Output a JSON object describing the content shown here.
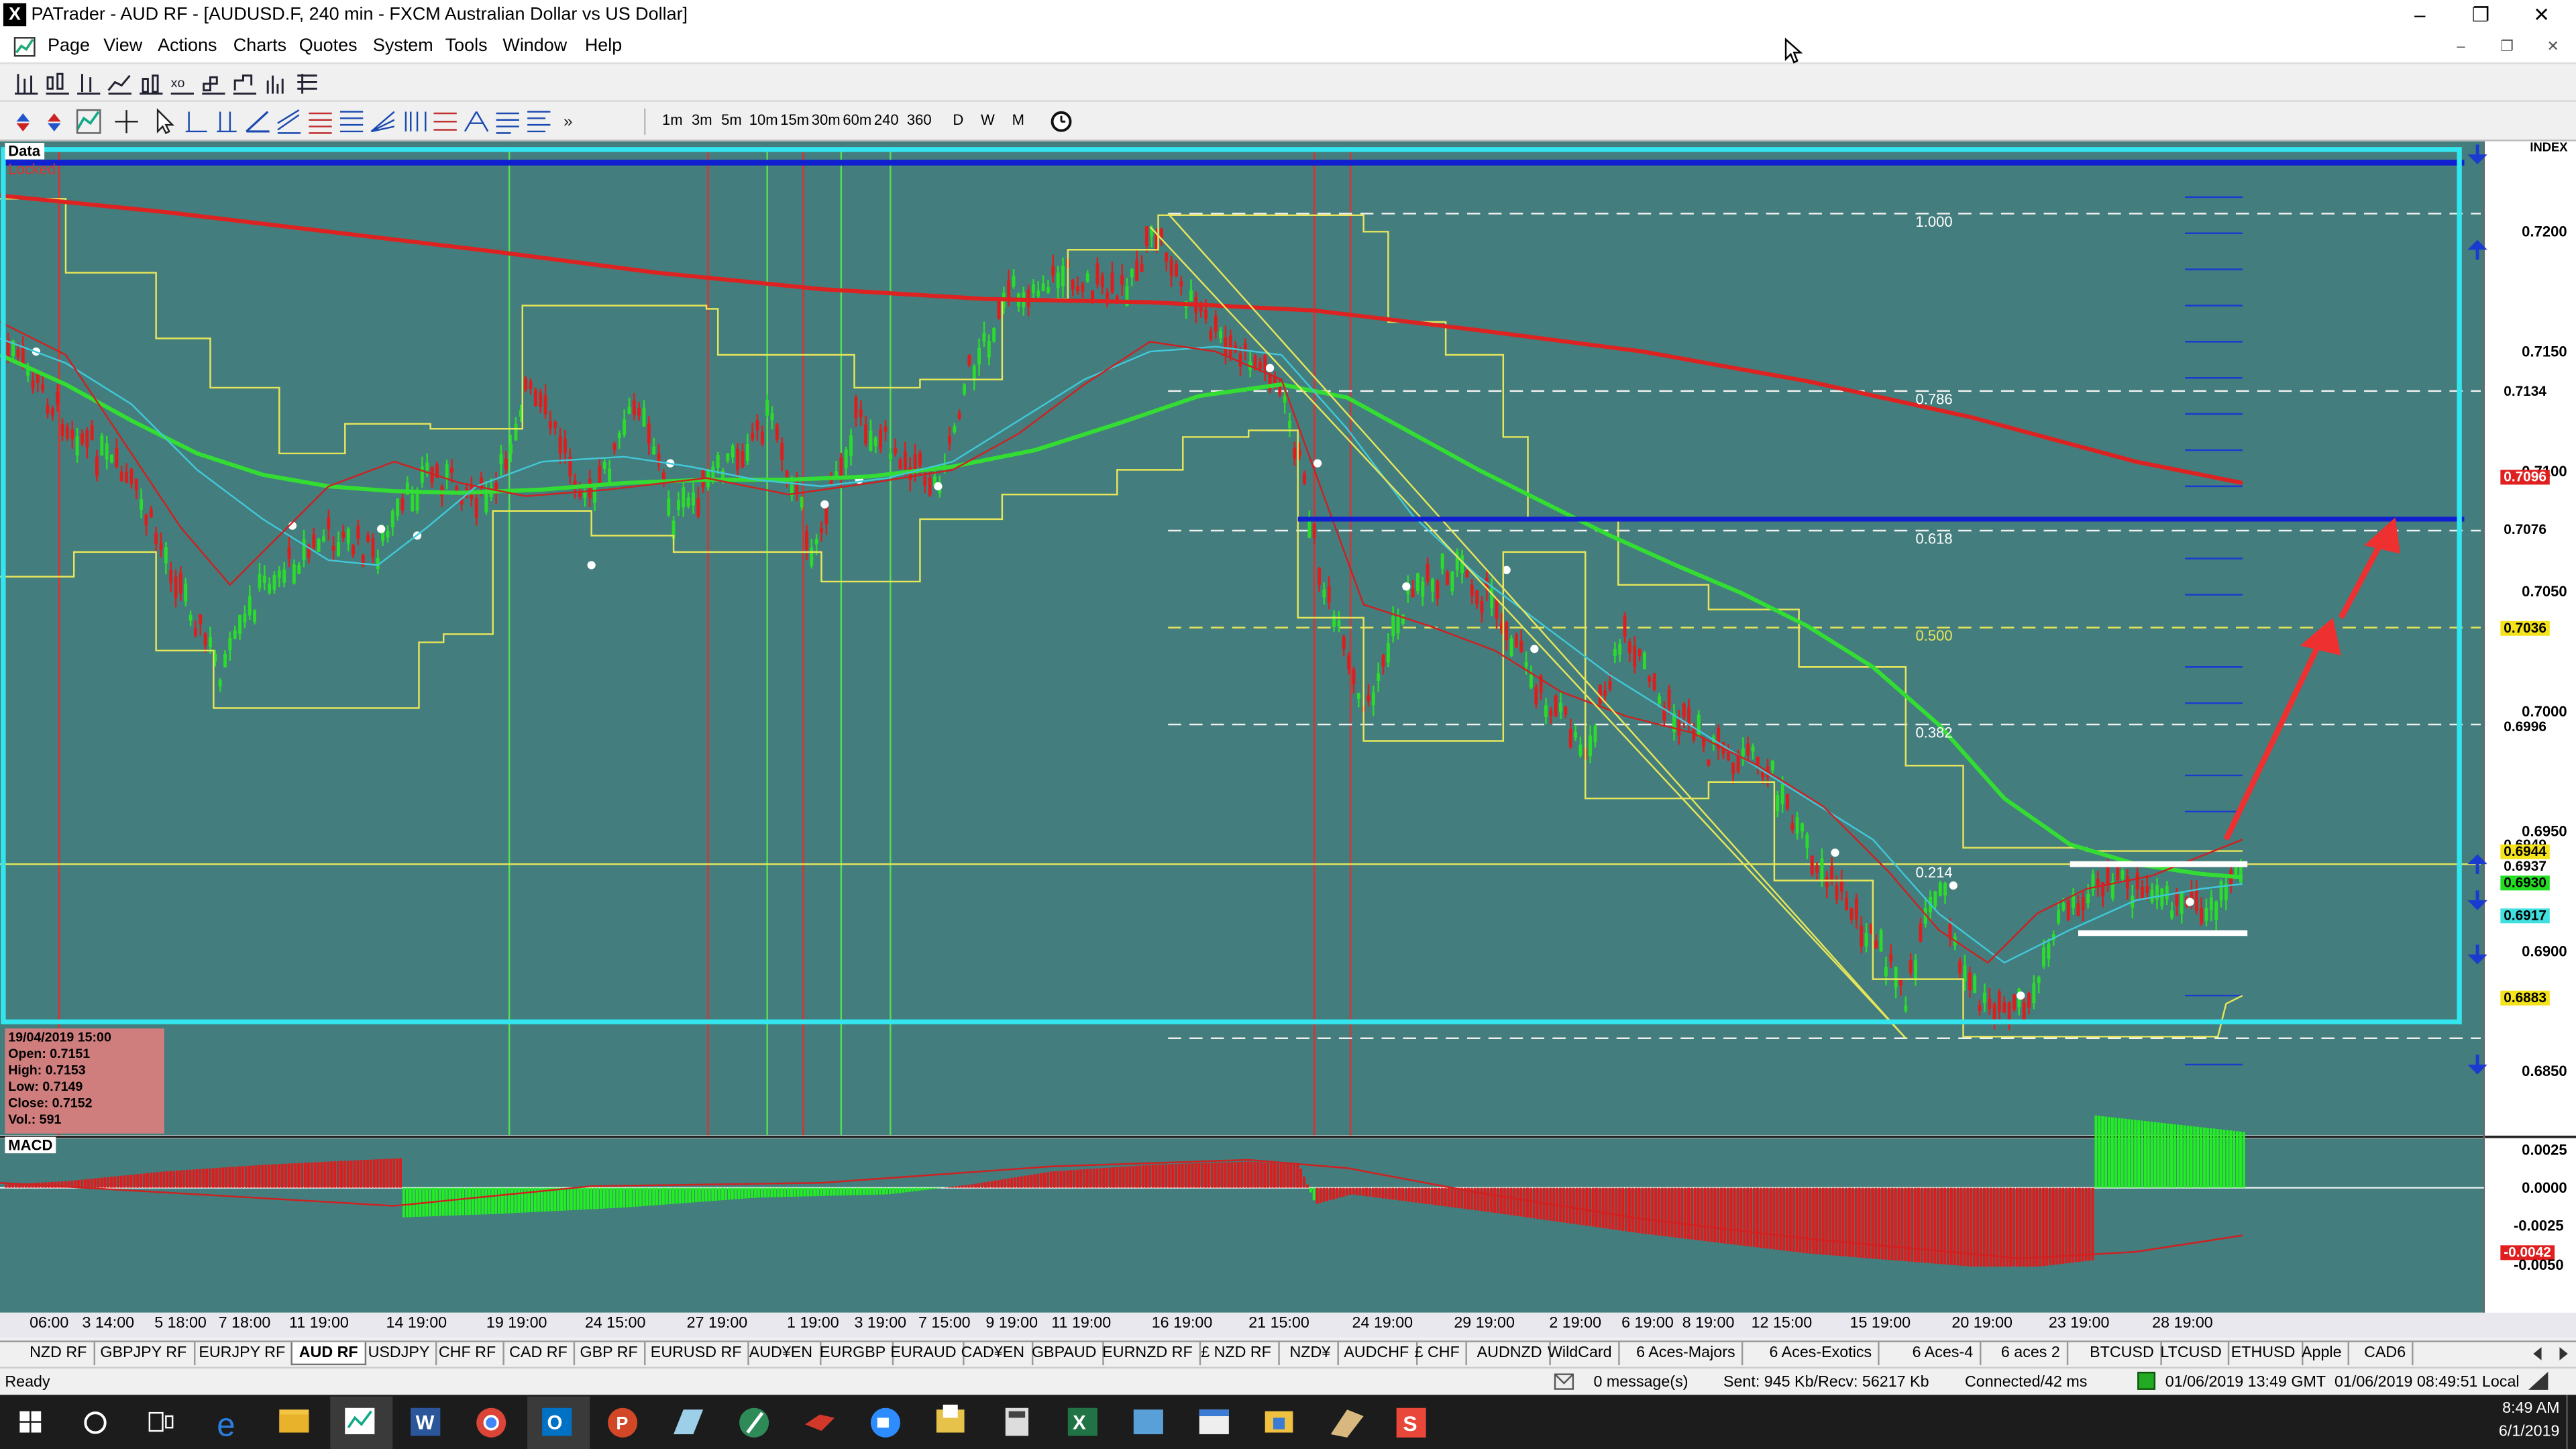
{
  "window": {
    "app_icon": "X",
    "title": "PATrader - AUD RF - [AUDUSD.F, 240 min - FXCM Australian Dollar vs US Dollar]",
    "min": "–",
    "max": "❐",
    "close": "✕"
  },
  "menu": {
    "items": [
      "Page",
      "View",
      "Actions",
      "Charts",
      "Quotes",
      "System",
      "Tools",
      "Window",
      "Help"
    ],
    "mdi_min": "–",
    "mdi_restore": "❐",
    "mdi_close": "✕"
  },
  "timeframes": [
    "1m",
    "3m",
    "5m",
    "10m",
    "15m",
    "30m",
    "60m",
    "240",
    "360",
    "D",
    "W",
    "M"
  ],
  "chart": {
    "data_label": "Data",
    "locked_label": "Locked",
    "index_label": "INDEX",
    "macd_label": "MACD",
    "price_axis": [
      "0.7200",
      "0.7150",
      "0.7100",
      "0.7050",
      "0.7000",
      "0.6950",
      "0.6900",
      "0.6850"
    ],
    "price_tags": [
      {
        "text": "0.7134",
        "bg": "#ffffff",
        "fg": "#000000"
      },
      {
        "text": "0.7096",
        "bg": "#e02020",
        "fg": "#ffffff"
      },
      {
        "text": "0.7076",
        "bg": "#ffffff",
        "fg": "#000000"
      },
      {
        "text": "0.7036",
        "bg": "#f4e21a",
        "fg": "#000000"
      },
      {
        "text": "0.6996",
        "bg": "#ffffff",
        "fg": "#000000"
      },
      {
        "text": "0.6949",
        "bg": "#ffffff",
        "fg": "#000000"
      },
      {
        "text": "0.6944",
        "bg": "#f4e21a",
        "fg": "#000000"
      },
      {
        "text": "0.6937",
        "bg": "#ffffff",
        "fg": "#000000"
      },
      {
        "text": "0.6930",
        "bg": "#22dd22",
        "fg": "#000000"
      },
      {
        "text": "0.6917",
        "bg": "#40e0e0",
        "fg": "#000000"
      },
      {
        "text": "0.6883",
        "bg": "#f4e21a",
        "fg": "#000000"
      }
    ],
    "fib_levels": [
      "1.000",
      "0.786",
      "0.618",
      "0.500",
      "0.382",
      "0.214"
    ],
    "macd_axis": [
      "0.0025",
      "0.0000",
      "-0.0025",
      "-0.0042",
      "-0.0050"
    ],
    "dates": [
      "06:00",
      "3 14:00",
      "5 18:00",
      "7 18:00",
      "11 19:00",
      "14 19:00",
      "19 19:00",
      "24 15:00",
      "27 19:00",
      "1 19:00",
      "3 19:00",
      "7 15:00",
      "9 19:00",
      "11 19:00",
      "16 19:00",
      "21 15:00",
      "24 19:00",
      "29 19:00",
      "2 19:00",
      "6 19:00",
      "8 19:00",
      "12 15:00",
      "15 19:00",
      "20 19:00",
      "23 19:00",
      "28 19:00"
    ]
  },
  "ohlc": {
    "date": "19/04/2019 15:00",
    "open": "Open: 0.7151",
    "high": "High: 0.7153",
    "low": "Low: 0.7149",
    "close": "Close: 0.7152",
    "vol": "Vol.: 591"
  },
  "symbol_tabs": [
    "NZD RF",
    "GBPJPY RF",
    "EURJPY RF",
    "AUD RF",
    "USDJPY",
    "CHF RF",
    "CAD RF",
    "GBP RF",
    "EURUSD RF",
    "AUD¥EN",
    "EURGBP",
    "EURAUD",
    "CAD¥EN",
    "GBPAUD",
    "EURNZD RF",
    "£ NZD RF",
    "NZD¥",
    "AUDCHF",
    "£ CHF",
    "AUDNZD",
    "WildCard",
    "6 Aces-Majors",
    "6 Aces-Exotics",
    "6 Aces-4",
    "6 aces 2",
    "BTCUSD",
    "LTCUSD",
    "ETHUSD",
    "Apple",
    "CAD6"
  ],
  "active_tab": "AUD RF",
  "status": {
    "ready": "Ready",
    "messages": "0 message(s)",
    "traffic": "Sent: 945 Kb/Recv: 56217 Kb",
    "connection": "Connected/42 ms",
    "gmt_time": "01/06/2019 13:49 GMT",
    "local_time": "01/06/2019 08:49:51 Local"
  },
  "taskbar": {
    "time": "8:49 AM",
    "date": "6/1/2019",
    "apps": [
      "start-icon",
      "cortana-icon",
      "task-view-icon",
      "edge-icon",
      "explorer-icon",
      "patrader-icon",
      "word-icon",
      "chrome-icon",
      "outlook-icon",
      "powerpoint-icon",
      "notes-icon",
      "ninja-icon",
      "app-bird-icon",
      "zoom-icon",
      "folder-doc-icon",
      "calculator-icon",
      "excel-icon",
      "app-blue-icon",
      "app-window-icon",
      "app-folder-icon",
      "app-tool-icon",
      "snagit-icon"
    ]
  },
  "colors": {
    "chart_bg": "#447d7d",
    "up_candle": "#2bdc2b",
    "down_candle": "#e01d1d",
    "ma_red": "#dd2222",
    "ma_green": "#33dd33",
    "ma_cyan": "#40c8d8",
    "channel_yellow": "#e6e65a",
    "level_blue": "#1020d0",
    "box_cyan": "#33e5ee"
  }
}
